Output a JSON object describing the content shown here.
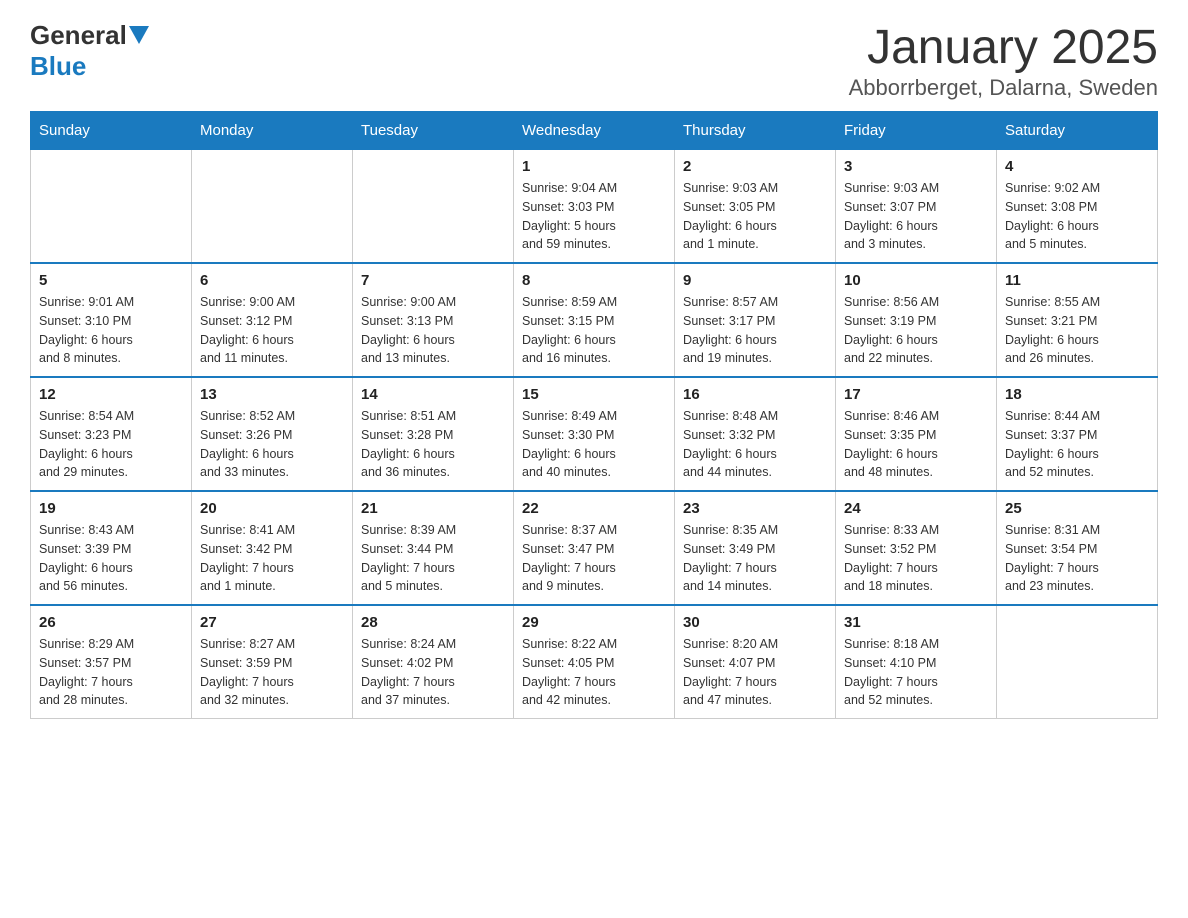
{
  "logo": {
    "general": "General",
    "blue": "Blue"
  },
  "title": "January 2025",
  "subtitle": "Abborrberget, Dalarna, Sweden",
  "headers": [
    "Sunday",
    "Monday",
    "Tuesday",
    "Wednesday",
    "Thursday",
    "Friday",
    "Saturday"
  ],
  "weeks": [
    [
      {
        "day": "",
        "info": ""
      },
      {
        "day": "",
        "info": ""
      },
      {
        "day": "",
        "info": ""
      },
      {
        "day": "1",
        "info": "Sunrise: 9:04 AM\nSunset: 3:03 PM\nDaylight: 5 hours\nand 59 minutes."
      },
      {
        "day": "2",
        "info": "Sunrise: 9:03 AM\nSunset: 3:05 PM\nDaylight: 6 hours\nand 1 minute."
      },
      {
        "day": "3",
        "info": "Sunrise: 9:03 AM\nSunset: 3:07 PM\nDaylight: 6 hours\nand 3 minutes."
      },
      {
        "day": "4",
        "info": "Sunrise: 9:02 AM\nSunset: 3:08 PM\nDaylight: 6 hours\nand 5 minutes."
      }
    ],
    [
      {
        "day": "5",
        "info": "Sunrise: 9:01 AM\nSunset: 3:10 PM\nDaylight: 6 hours\nand 8 minutes."
      },
      {
        "day": "6",
        "info": "Sunrise: 9:00 AM\nSunset: 3:12 PM\nDaylight: 6 hours\nand 11 minutes."
      },
      {
        "day": "7",
        "info": "Sunrise: 9:00 AM\nSunset: 3:13 PM\nDaylight: 6 hours\nand 13 minutes."
      },
      {
        "day": "8",
        "info": "Sunrise: 8:59 AM\nSunset: 3:15 PM\nDaylight: 6 hours\nand 16 minutes."
      },
      {
        "day": "9",
        "info": "Sunrise: 8:57 AM\nSunset: 3:17 PM\nDaylight: 6 hours\nand 19 minutes."
      },
      {
        "day": "10",
        "info": "Sunrise: 8:56 AM\nSunset: 3:19 PM\nDaylight: 6 hours\nand 22 minutes."
      },
      {
        "day": "11",
        "info": "Sunrise: 8:55 AM\nSunset: 3:21 PM\nDaylight: 6 hours\nand 26 minutes."
      }
    ],
    [
      {
        "day": "12",
        "info": "Sunrise: 8:54 AM\nSunset: 3:23 PM\nDaylight: 6 hours\nand 29 minutes."
      },
      {
        "day": "13",
        "info": "Sunrise: 8:52 AM\nSunset: 3:26 PM\nDaylight: 6 hours\nand 33 minutes."
      },
      {
        "day": "14",
        "info": "Sunrise: 8:51 AM\nSunset: 3:28 PM\nDaylight: 6 hours\nand 36 minutes."
      },
      {
        "day": "15",
        "info": "Sunrise: 8:49 AM\nSunset: 3:30 PM\nDaylight: 6 hours\nand 40 minutes."
      },
      {
        "day": "16",
        "info": "Sunrise: 8:48 AM\nSunset: 3:32 PM\nDaylight: 6 hours\nand 44 minutes."
      },
      {
        "day": "17",
        "info": "Sunrise: 8:46 AM\nSunset: 3:35 PM\nDaylight: 6 hours\nand 48 minutes."
      },
      {
        "day": "18",
        "info": "Sunrise: 8:44 AM\nSunset: 3:37 PM\nDaylight: 6 hours\nand 52 minutes."
      }
    ],
    [
      {
        "day": "19",
        "info": "Sunrise: 8:43 AM\nSunset: 3:39 PM\nDaylight: 6 hours\nand 56 minutes."
      },
      {
        "day": "20",
        "info": "Sunrise: 8:41 AM\nSunset: 3:42 PM\nDaylight: 7 hours\nand 1 minute."
      },
      {
        "day": "21",
        "info": "Sunrise: 8:39 AM\nSunset: 3:44 PM\nDaylight: 7 hours\nand 5 minutes."
      },
      {
        "day": "22",
        "info": "Sunrise: 8:37 AM\nSunset: 3:47 PM\nDaylight: 7 hours\nand 9 minutes."
      },
      {
        "day": "23",
        "info": "Sunrise: 8:35 AM\nSunset: 3:49 PM\nDaylight: 7 hours\nand 14 minutes."
      },
      {
        "day": "24",
        "info": "Sunrise: 8:33 AM\nSunset: 3:52 PM\nDaylight: 7 hours\nand 18 minutes."
      },
      {
        "day": "25",
        "info": "Sunrise: 8:31 AM\nSunset: 3:54 PM\nDaylight: 7 hours\nand 23 minutes."
      }
    ],
    [
      {
        "day": "26",
        "info": "Sunrise: 8:29 AM\nSunset: 3:57 PM\nDaylight: 7 hours\nand 28 minutes."
      },
      {
        "day": "27",
        "info": "Sunrise: 8:27 AM\nSunset: 3:59 PM\nDaylight: 7 hours\nand 32 minutes."
      },
      {
        "day": "28",
        "info": "Sunrise: 8:24 AM\nSunset: 4:02 PM\nDaylight: 7 hours\nand 37 minutes."
      },
      {
        "day": "29",
        "info": "Sunrise: 8:22 AM\nSunset: 4:05 PM\nDaylight: 7 hours\nand 42 minutes."
      },
      {
        "day": "30",
        "info": "Sunrise: 8:20 AM\nSunset: 4:07 PM\nDaylight: 7 hours\nand 47 minutes."
      },
      {
        "day": "31",
        "info": "Sunrise: 8:18 AM\nSunset: 4:10 PM\nDaylight: 7 hours\nand 52 minutes."
      },
      {
        "day": "",
        "info": ""
      }
    ]
  ]
}
